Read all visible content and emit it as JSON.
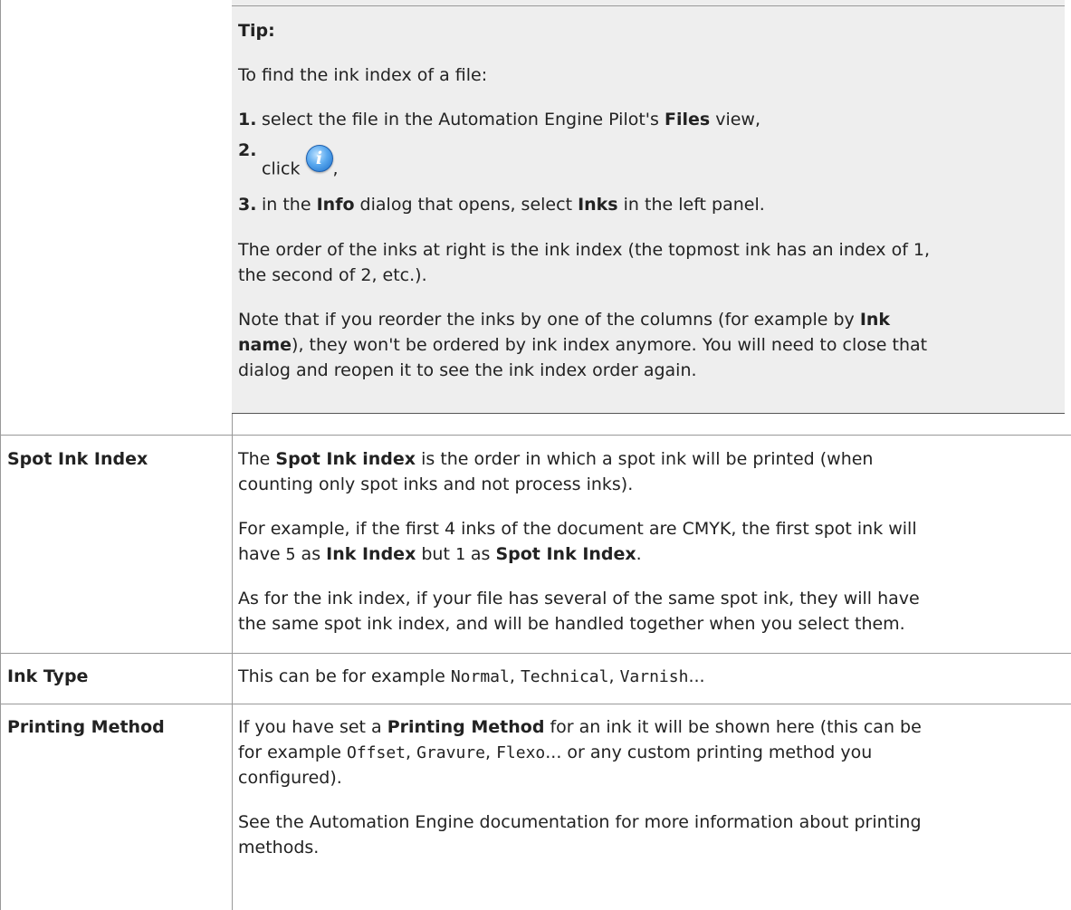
{
  "tip": {
    "heading": "Tip:",
    "intro": "To find the ink index of a file:",
    "steps": [
      {
        "num": "1.",
        "t1": "select the file in the Automation Engine Pilot's ",
        "b1": "Files",
        "t2": " view,"
      },
      {
        "num": "2.",
        "t1": "click ",
        "icon": "info-icon",
        "t2": ","
      },
      {
        "num": "3.",
        "t1": "in the ",
        "b1": "Info",
        "t2": " dialog that opens, select ",
        "b2": "Inks",
        "t3": " in the left panel."
      }
    ],
    "order_line1": "The order of the inks at right is the ink index (the topmost ink has an index of 1,",
    "order_line2": "the second of 2, etc.).",
    "note_line1_a": "Note that if you reorder the inks by one of the columns (for example by ",
    "note_line1_b": "Ink",
    "note_line2_a": "name",
    "note_line2_b": "), they won't be ordered by ink index anymore. You will need to close that",
    "note_line3": "dialog and reopen it to see the ink index order again."
  },
  "rows": {
    "spot": {
      "label": "Spot Ink Index",
      "p1_a": "The ",
      "p1_b": "Spot Ink index",
      "p1_c": " is the order in which a spot ink will be printed (when",
      "p1_line2": "counting only spot inks and not process inks).",
      "p2_line1": "For example, if the first 4 inks of the document are CMYK, the first spot ink will",
      "p2_a": "have ",
      "p2_code1": "5",
      "p2_b": " as ",
      "p2_bold1": "Ink Index",
      "p2_c": " but ",
      "p2_code2": "1",
      "p2_d": " as ",
      "p2_bold2": "Spot Ink Index",
      "p2_e": ".",
      "p3_line1": "As for the ink index, if your file has several of the same spot ink, they will have",
      "p3_line2": "the same spot ink index, and will be handled together when you select them."
    },
    "type": {
      "label": "Ink Type",
      "a": "This can be for example ",
      "c1": "Normal",
      "s1": ", ",
      "c2": "Technical",
      "s2": ", ",
      "c3": "Varnish",
      "s3": "..."
    },
    "printing": {
      "label": "Printing Method",
      "p1_a": "If you have set a ",
      "p1_b": "Printing Method",
      "p1_c": " for an ink it will be shown here (this can be",
      "p1_d": "for example ",
      "p1_code1": "Offset",
      "p1_s1": ", ",
      "p1_code2": "Gravure",
      "p1_s2": ", ",
      "p1_code3": "Flexo",
      "p1_e": "... or any custom printing method you",
      "p1_line3": "configured).",
      "p2_line1": "See the Automation Engine documentation for more information about printing",
      "p2_line2": "methods."
    }
  }
}
